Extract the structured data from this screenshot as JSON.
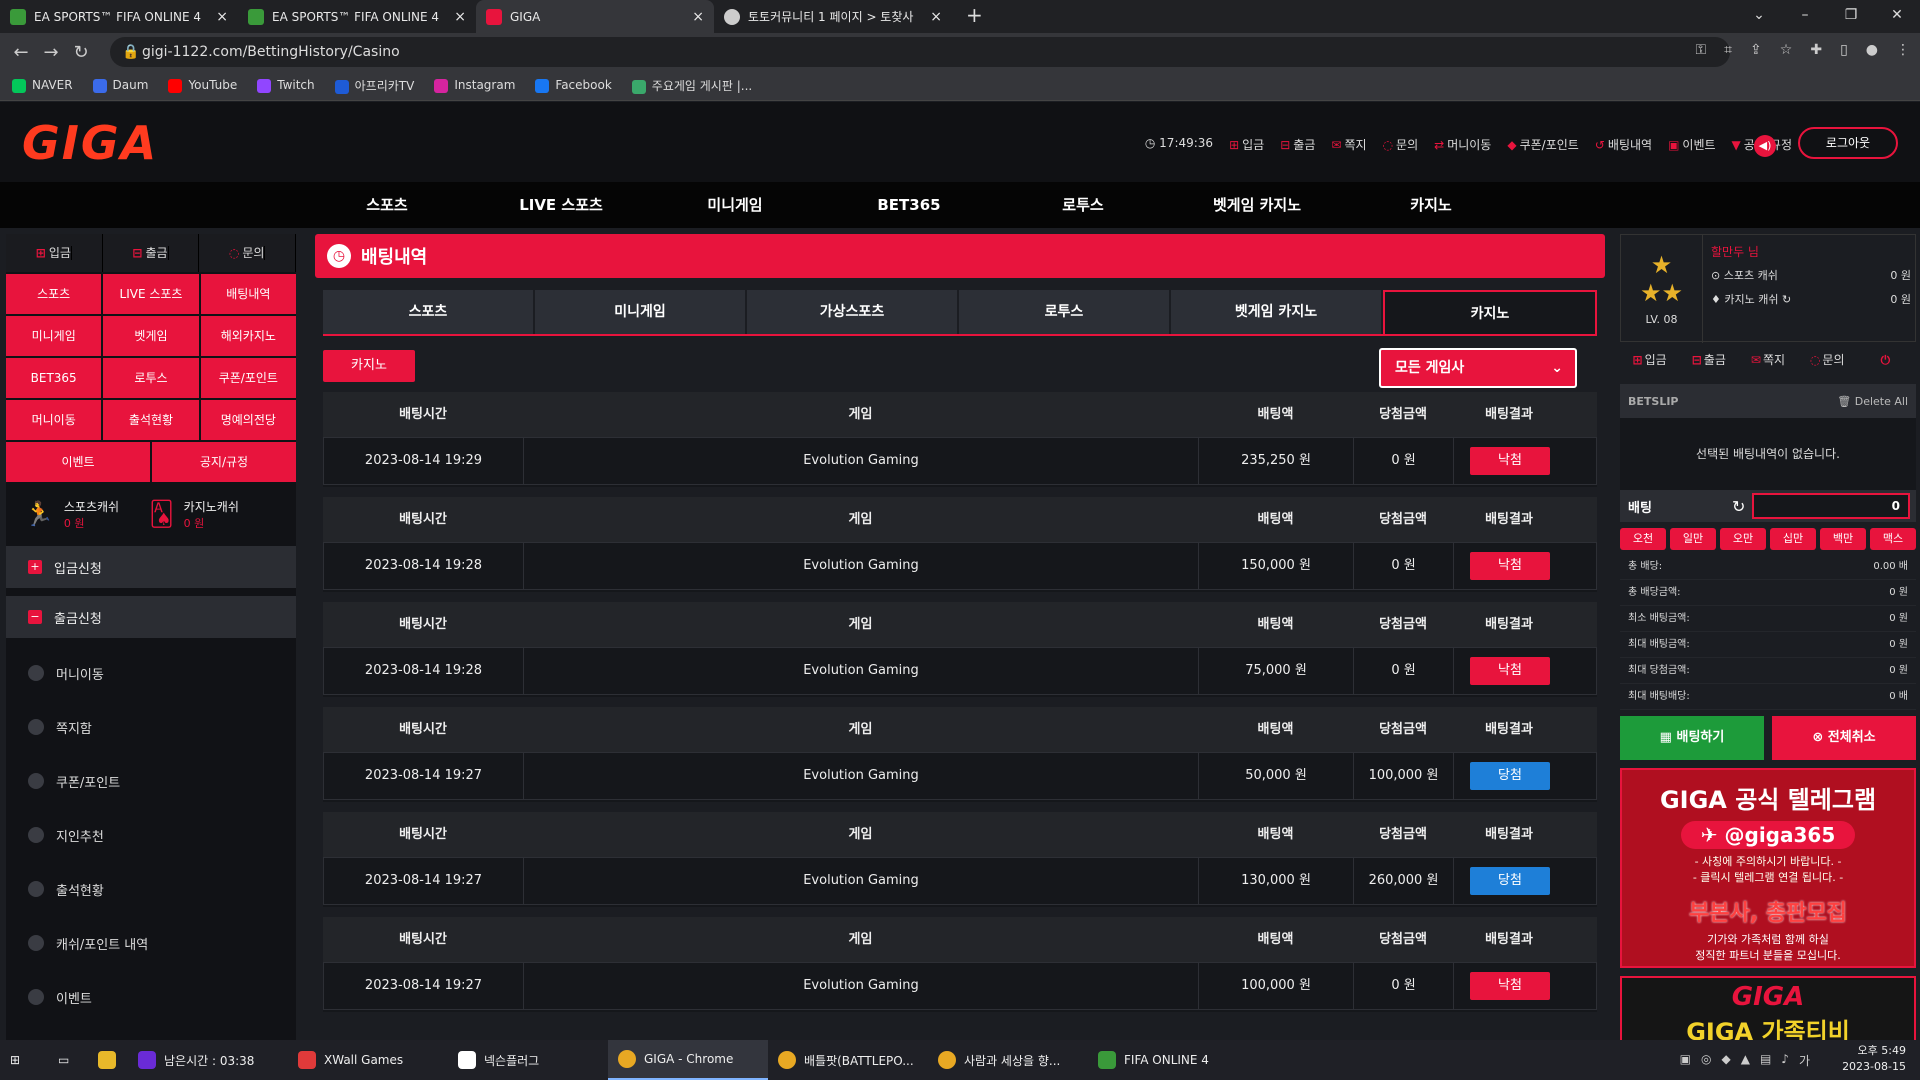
{
  "browser": {
    "tabs": [
      {
        "title": "EA SPORTS™ FIFA ONLINE 4",
        "color": "#3a9a3a"
      },
      {
        "title": "EA SPORTS™ FIFA ONLINE 4",
        "color": "#3a9a3a"
      },
      {
        "title": "GIGA",
        "color": "#e8143d"
      },
      {
        "title": "토토커뮤니티 1 페이지 > 토찾사",
        "color": "#cccccc"
      }
    ],
    "url": "gigi-1122.com/BettingHistory/Casino",
    "bookmarks": [
      {
        "label": "NAVER",
        "color": "#03c75a"
      },
      {
        "label": "Daum",
        "color": "#3b6bea"
      },
      {
        "label": "YouTube",
        "color": "#ff0000"
      },
      {
        "label": "Twitch",
        "color": "#9146ff"
      },
      {
        "label": "아프리카TV",
        "color": "#1e5bd6"
      },
      {
        "label": "Instagram",
        "color": "#d6249f"
      },
      {
        "label": "Facebook",
        "color": "#1877f2"
      },
      {
        "label": "주요게임 게시판 |...",
        "color": "#3aa86b"
      }
    ]
  },
  "header": {
    "logo": "GIGA",
    "time": "17:49:36",
    "links": [
      "입금",
      "출금",
      "쪽지",
      "문의",
      "머니이동",
      "쿠폰/포인트",
      "배팅내역",
      "이벤트",
      "공지/규정"
    ],
    "logout": "로그아웃"
  },
  "mainnav": [
    "스포츠",
    "LIVE 스포츠",
    "미니게임",
    "BET365",
    "로투스",
    "벳게임 카지노",
    "카지노"
  ],
  "sidebar": {
    "quick": [
      "입금",
      "출금",
      "문의"
    ],
    "grid": [
      "스포츠",
      "LIVE 스포츠",
      "배팅내역",
      "미니게임",
      "벳게임",
      "해외카지노",
      "BET365",
      "로투스",
      "쿠폰/포인트",
      "머니이동",
      "출석현황",
      "명예의전당"
    ],
    "grid2": [
      "이벤트",
      "공지/규정"
    ],
    "sports_cash": {
      "label": "스포츠캐쉬",
      "value": "0 원"
    },
    "casino_cash": {
      "label": "카지노캐쉬",
      "value": "0 원"
    },
    "deposit_req": "입금신청",
    "withdraw_req": "출금신청",
    "items": [
      "머니이동",
      "쪽지함",
      "쿠폰/포인트",
      "지인추천",
      "출석현황",
      "캐쉬/포인트 내역",
      "이벤트"
    ]
  },
  "content": {
    "title": "배팅내역",
    "tabs": [
      "스포츠",
      "미니게임",
      "가상스포츠",
      "로투스",
      "벳게임 카지노",
      "카지노"
    ],
    "sub_button": "카지노",
    "provider_select": "모든 게임사",
    "columns": [
      "배팅시간",
      "게임",
      "배팅액",
      "당첨금액",
      "배팅결과"
    ],
    "rows": [
      {
        "time": "2023-08-14 19:29",
        "game": "Evolution Gaming",
        "bet": "235,250 원",
        "win": "0 원",
        "result": "낙첨",
        "type": "lose"
      },
      {
        "time": "2023-08-14 19:28",
        "game": "Evolution Gaming",
        "bet": "150,000 원",
        "win": "0 원",
        "result": "낙첨",
        "type": "lose"
      },
      {
        "time": "2023-08-14 19:28",
        "game": "Evolution Gaming",
        "bet": "75,000 원",
        "win": "0 원",
        "result": "낙첨",
        "type": "lose"
      },
      {
        "time": "2023-08-14 19:27",
        "game": "Evolution Gaming",
        "bet": "50,000 원",
        "win": "100,000 원",
        "result": "당첨",
        "type": "win"
      },
      {
        "time": "2023-08-14 19:27",
        "game": "Evolution Gaming",
        "bet": "130,000 원",
        "win": "260,000 원",
        "result": "당첨",
        "type": "win"
      },
      {
        "time": "2023-08-14 19:27",
        "game": "Evolution Gaming",
        "bet": "100,000 원",
        "win": "0 원",
        "result": "낙첨",
        "type": "lose"
      }
    ]
  },
  "profile": {
    "name": "할만두 님",
    "level": "LV. 08",
    "sports_cash_label": "스포츠 캐쉬",
    "sports_cash": "0 원",
    "casino_cash_label": "카지노 캐쉬",
    "casino_cash": "0 원",
    "icons": [
      "입금",
      "출금",
      "쪽지",
      "문의"
    ]
  },
  "betslip": {
    "title": "BETSLIP",
    "delete": "Delete All",
    "empty": "선택된 배팅내역이 없습니다.",
    "bet_label": "배팅",
    "amount": "0",
    "chips": [
      "오천",
      "일만",
      "오만",
      "십만",
      "백만",
      "맥스"
    ],
    "stats": [
      {
        "label": "총 배당:",
        "value": "0.00 배"
      },
      {
        "label": "총 배당금액:",
        "value": "0 원"
      },
      {
        "label": "최소 배팅금액:",
        "value": "0 원"
      },
      {
        "label": "최대 배팅금액:",
        "value": "0 원"
      },
      {
        "label": "최대 당첨금액:",
        "value": "0 원"
      },
      {
        "label": "최대 배팅배당:",
        "value": "0 배"
      }
    ],
    "place": "배팅하기",
    "cancel": "전체취소"
  },
  "promo": {
    "t1": "GIGA 공식 텔레그램",
    "t2": "@giga365",
    "t3a": "- 사칭에 주의하시기 바랍니다. -",
    "t3b": "- 클릭시 텔레그램 연결 됩니다. -",
    "t4": "부본사, 총판모집",
    "t5a": "기가와 가족처럼 함께 하실",
    "t5b": "정직한 파트너 분들을 모십니다.",
    "b1": "GIGA",
    "b2": "GIGA 가족티비"
  },
  "taskbar": {
    "items": [
      {
        "label": "남은시간 : 03:38",
        "color": "#6a2bd6"
      },
      {
        "label": "XWall Games",
        "color": "#e03a3a"
      },
      {
        "label": "넥슨플러그",
        "color": "#333333"
      },
      {
        "label": "GIGA - Chrome",
        "color": "#e8a823"
      },
      {
        "label": "배틀팟(BATTLEPO...",
        "color": "#e8a823"
      },
      {
        "label": "사람과 세상을 향...",
        "color": "#e8a823"
      },
      {
        "label": "FIFA ONLINE 4",
        "color": "#3a9a3a"
      }
    ],
    "time": "오후 5:49",
    "date": "2023-08-15"
  }
}
